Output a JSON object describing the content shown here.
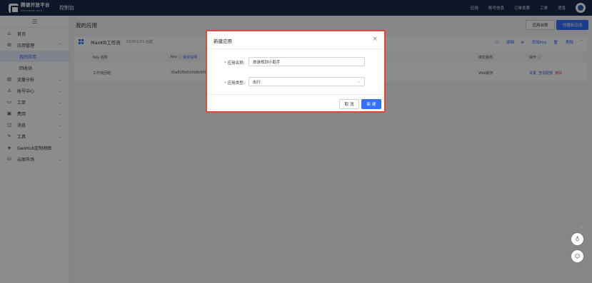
{
  "topbar": {
    "brand_cn": "腾德开放平台",
    "brand_en": "dev.qwequ.com",
    "console": "控制台",
    "nav": [
      "应用",
      "账号信息",
      "订单发票",
      "工单",
      "消息"
    ]
  },
  "sidebar": {
    "items": [
      {
        "label": "首页",
        "icon": "home-icon"
      },
      {
        "label": "应用管理",
        "icon": "grid-icon",
        "expandable": true
      },
      {
        "label": "我的应用",
        "sub": true,
        "active": true
      },
      {
        "label": "回收站",
        "sub": true
      },
      {
        "label": "流量分析",
        "icon": "chart-icon",
        "expandable": true
      },
      {
        "label": "账号中心",
        "icon": "user-icon",
        "expandable": true
      },
      {
        "label": "工单",
        "icon": "ticket-icon",
        "expandable": true
      },
      {
        "label": "费用",
        "icon": "fee-icon",
        "expandable": true
      },
      {
        "label": "消息",
        "icon": "message-icon",
        "expandable": true
      },
      {
        "label": "工具",
        "icon": "wrench-icon",
        "expandable": true
      },
      {
        "label": "GeoHub定制地图",
        "icon": "layers-icon"
      },
      {
        "label": "云图市场",
        "icon": "database-icon",
        "expandable": true
      }
    ]
  },
  "main": {
    "page_title": "我的应用",
    "btn_list": "应用台账",
    "btn_new": "创建新应用",
    "card": {
      "app_name": "MaxKB工作流",
      "created": "2026/1/21 创建",
      "actions": [
        "编辑",
        "添加Key",
        "删除"
      ],
      "columns": {
        "key_name": "Key 名称",
        "key": "Key",
        "key_help": "服务说明",
        "bound_service": "绑定服务",
        "ops": "操作"
      },
      "row": {
        "key_name": "工作流回组",
        "key": "30a826b0d2b6b6f9",
        "service": "Web服务",
        "ops": [
          "设置",
          "查看配额",
          "删除"
        ]
      }
    }
  },
  "modal": {
    "title": "新建应用",
    "name_label": "应用名称:",
    "name_value": "旅游规划小助手",
    "type_label": "应用类型:",
    "type_value": "出行",
    "cancel": "取 消",
    "confirm": "新 建"
  }
}
